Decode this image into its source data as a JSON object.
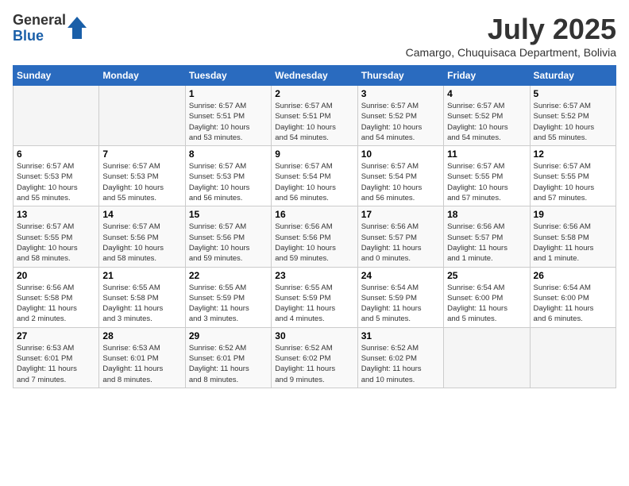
{
  "logo": {
    "general": "General",
    "blue": "Blue"
  },
  "title": "July 2025",
  "location": "Camargo, Chuquisaca Department, Bolivia",
  "days_header": [
    "Sunday",
    "Monday",
    "Tuesday",
    "Wednesday",
    "Thursday",
    "Friday",
    "Saturday"
  ],
  "weeks": [
    [
      {
        "day": "",
        "info": ""
      },
      {
        "day": "",
        "info": ""
      },
      {
        "day": "1",
        "info": "Sunrise: 6:57 AM\nSunset: 5:51 PM\nDaylight: 10 hours\nand 53 minutes."
      },
      {
        "day": "2",
        "info": "Sunrise: 6:57 AM\nSunset: 5:51 PM\nDaylight: 10 hours\nand 54 minutes."
      },
      {
        "day": "3",
        "info": "Sunrise: 6:57 AM\nSunset: 5:52 PM\nDaylight: 10 hours\nand 54 minutes."
      },
      {
        "day": "4",
        "info": "Sunrise: 6:57 AM\nSunset: 5:52 PM\nDaylight: 10 hours\nand 54 minutes."
      },
      {
        "day": "5",
        "info": "Sunrise: 6:57 AM\nSunset: 5:52 PM\nDaylight: 10 hours\nand 55 minutes."
      }
    ],
    [
      {
        "day": "6",
        "info": "Sunrise: 6:57 AM\nSunset: 5:53 PM\nDaylight: 10 hours\nand 55 minutes."
      },
      {
        "day": "7",
        "info": "Sunrise: 6:57 AM\nSunset: 5:53 PM\nDaylight: 10 hours\nand 55 minutes."
      },
      {
        "day": "8",
        "info": "Sunrise: 6:57 AM\nSunset: 5:53 PM\nDaylight: 10 hours\nand 56 minutes."
      },
      {
        "day": "9",
        "info": "Sunrise: 6:57 AM\nSunset: 5:54 PM\nDaylight: 10 hours\nand 56 minutes."
      },
      {
        "day": "10",
        "info": "Sunrise: 6:57 AM\nSunset: 5:54 PM\nDaylight: 10 hours\nand 56 minutes."
      },
      {
        "day": "11",
        "info": "Sunrise: 6:57 AM\nSunset: 5:55 PM\nDaylight: 10 hours\nand 57 minutes."
      },
      {
        "day": "12",
        "info": "Sunrise: 6:57 AM\nSunset: 5:55 PM\nDaylight: 10 hours\nand 57 minutes."
      }
    ],
    [
      {
        "day": "13",
        "info": "Sunrise: 6:57 AM\nSunset: 5:55 PM\nDaylight: 10 hours\nand 58 minutes."
      },
      {
        "day": "14",
        "info": "Sunrise: 6:57 AM\nSunset: 5:56 PM\nDaylight: 10 hours\nand 58 minutes."
      },
      {
        "day": "15",
        "info": "Sunrise: 6:57 AM\nSunset: 5:56 PM\nDaylight: 10 hours\nand 59 minutes."
      },
      {
        "day": "16",
        "info": "Sunrise: 6:56 AM\nSunset: 5:56 PM\nDaylight: 10 hours\nand 59 minutes."
      },
      {
        "day": "17",
        "info": "Sunrise: 6:56 AM\nSunset: 5:57 PM\nDaylight: 11 hours\nand 0 minutes."
      },
      {
        "day": "18",
        "info": "Sunrise: 6:56 AM\nSunset: 5:57 PM\nDaylight: 11 hours\nand 1 minute."
      },
      {
        "day": "19",
        "info": "Sunrise: 6:56 AM\nSunset: 5:58 PM\nDaylight: 11 hours\nand 1 minute."
      }
    ],
    [
      {
        "day": "20",
        "info": "Sunrise: 6:56 AM\nSunset: 5:58 PM\nDaylight: 11 hours\nand 2 minutes."
      },
      {
        "day": "21",
        "info": "Sunrise: 6:55 AM\nSunset: 5:58 PM\nDaylight: 11 hours\nand 3 minutes."
      },
      {
        "day": "22",
        "info": "Sunrise: 6:55 AM\nSunset: 5:59 PM\nDaylight: 11 hours\nand 3 minutes."
      },
      {
        "day": "23",
        "info": "Sunrise: 6:55 AM\nSunset: 5:59 PM\nDaylight: 11 hours\nand 4 minutes."
      },
      {
        "day": "24",
        "info": "Sunrise: 6:54 AM\nSunset: 5:59 PM\nDaylight: 11 hours\nand 5 minutes."
      },
      {
        "day": "25",
        "info": "Sunrise: 6:54 AM\nSunset: 6:00 PM\nDaylight: 11 hours\nand 5 minutes."
      },
      {
        "day": "26",
        "info": "Sunrise: 6:54 AM\nSunset: 6:00 PM\nDaylight: 11 hours\nand 6 minutes."
      }
    ],
    [
      {
        "day": "27",
        "info": "Sunrise: 6:53 AM\nSunset: 6:01 PM\nDaylight: 11 hours\nand 7 minutes."
      },
      {
        "day": "28",
        "info": "Sunrise: 6:53 AM\nSunset: 6:01 PM\nDaylight: 11 hours\nand 8 minutes."
      },
      {
        "day": "29",
        "info": "Sunrise: 6:52 AM\nSunset: 6:01 PM\nDaylight: 11 hours\nand 8 minutes."
      },
      {
        "day": "30",
        "info": "Sunrise: 6:52 AM\nSunset: 6:02 PM\nDaylight: 11 hours\nand 9 minutes."
      },
      {
        "day": "31",
        "info": "Sunrise: 6:52 AM\nSunset: 6:02 PM\nDaylight: 11 hours\nand 10 minutes."
      },
      {
        "day": "",
        "info": ""
      },
      {
        "day": "",
        "info": ""
      }
    ]
  ]
}
